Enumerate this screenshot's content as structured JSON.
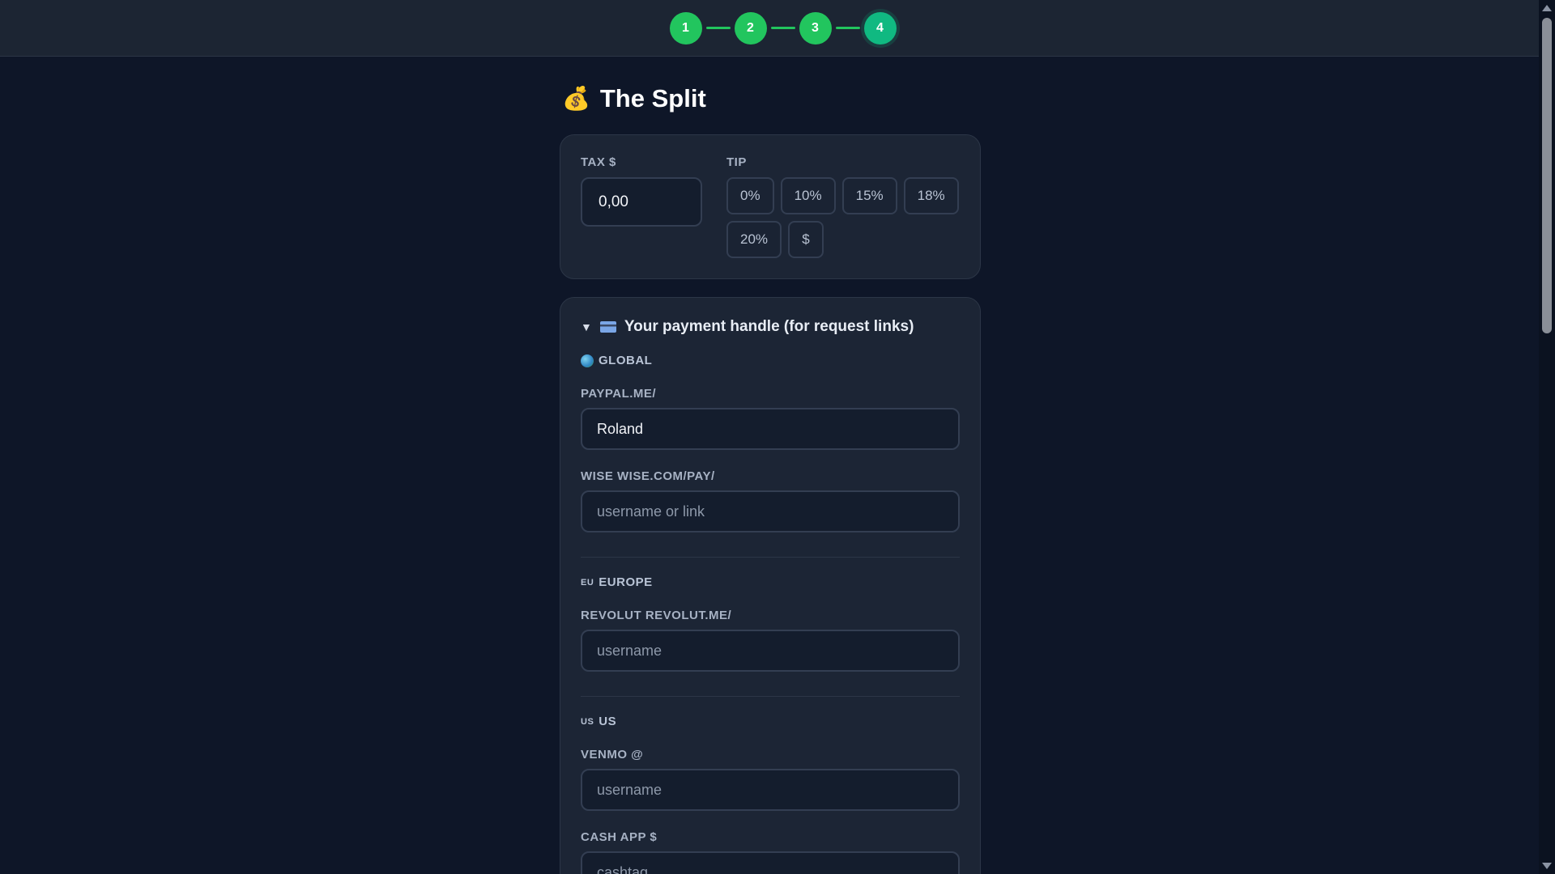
{
  "stepper": {
    "steps": [
      "1",
      "2",
      "3",
      "4"
    ],
    "current": "4",
    "accent": "#22c55e"
  },
  "page": {
    "title": "The Split",
    "title_icon": "money-bag-icon"
  },
  "tax": {
    "label": "TAX $",
    "value": "0,00"
  },
  "tip": {
    "label": "TIP",
    "options": [
      "0%",
      "10%",
      "15%",
      "18%",
      "20%",
      "$"
    ]
  },
  "payment_handle": {
    "title": "Your payment handle (for request links)",
    "expanded": true,
    "regions": [
      {
        "name": "GLOBAL",
        "icon": "globe-icon",
        "fields": [
          {
            "label": "PAYPAL.ME/",
            "value": "Roland",
            "placeholder": ""
          },
          {
            "label": "WISE WISE.COM/PAY/",
            "value": "",
            "placeholder": "username or link"
          }
        ]
      },
      {
        "name": "EUROPE",
        "icon_text": "EU",
        "fields": [
          {
            "label": "REVOLUT REVOLUT.ME/",
            "value": "",
            "placeholder": "username"
          }
        ]
      },
      {
        "name": "US",
        "icon_text": "US",
        "fields": [
          {
            "label": "VENMO @",
            "value": "",
            "placeholder": "username"
          },
          {
            "label": "CASH APP $",
            "value": "",
            "placeholder": "cashtag"
          }
        ]
      }
    ]
  }
}
